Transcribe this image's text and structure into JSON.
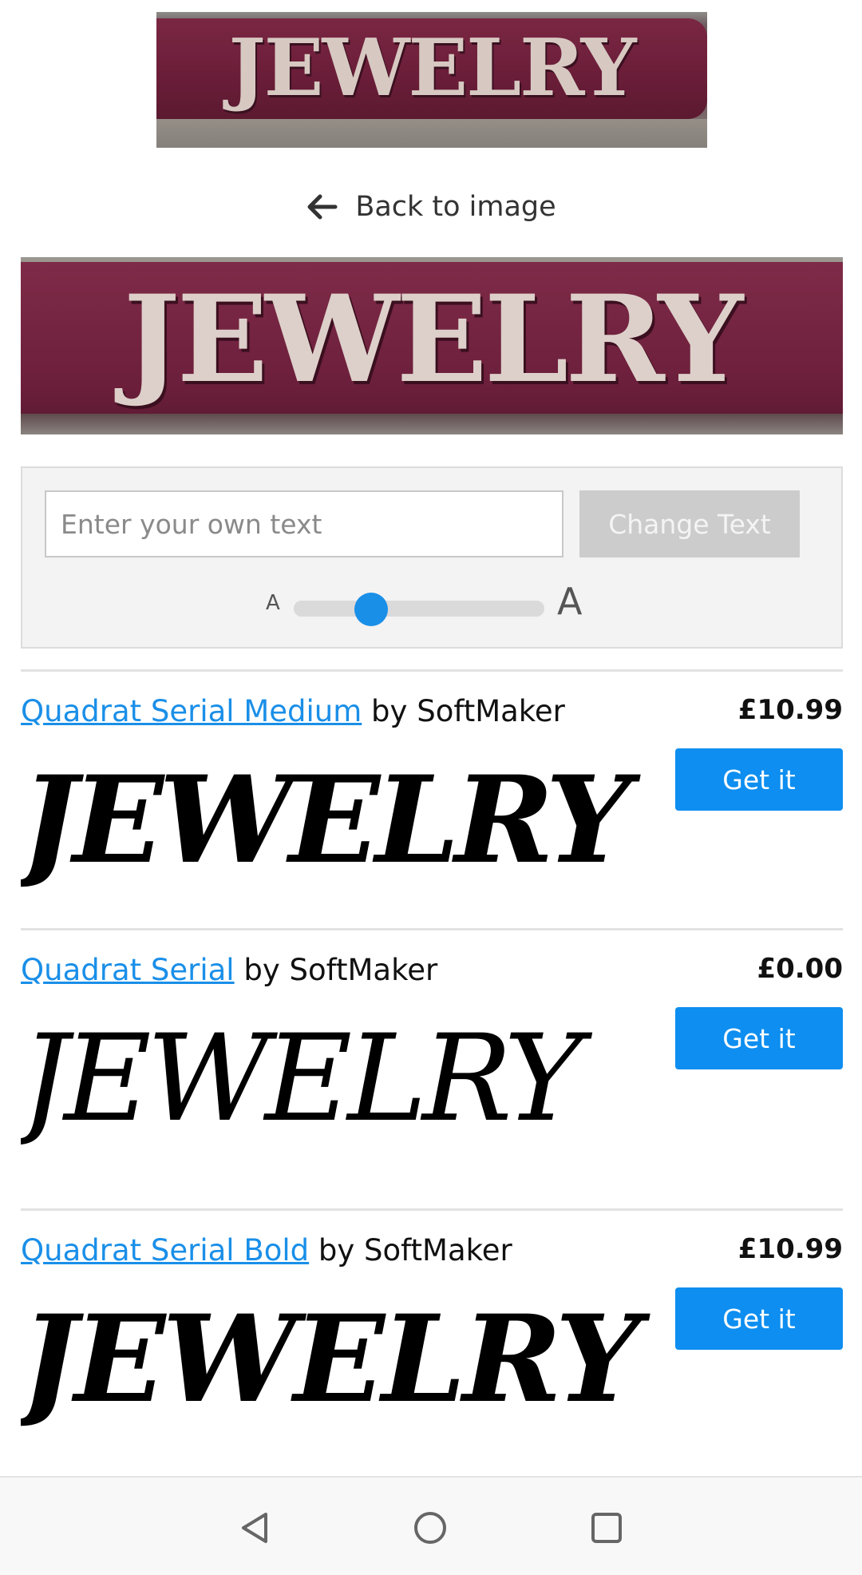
{
  "thumbnail": {
    "sign_text": "JEWELRY"
  },
  "back_link": {
    "label": "Back to image"
  },
  "crop": {
    "sign_text": "JEWELRY"
  },
  "controls": {
    "text_input_placeholder": "Enter your own text",
    "text_input_value": "",
    "change_text_label": "Change Text",
    "size_small_label": "A",
    "size_large_label": "A",
    "size_slider_fraction": 0.31,
    "accent_color": "#1a8fe8"
  },
  "results": [
    {
      "font_name": "Quadrat Serial Medium",
      "by_text": " by SoftMaker",
      "price": "£10.99",
      "button_label": "Get it",
      "sample": "JEWELRY"
    },
    {
      "font_name": "Quadrat Serial",
      "by_text": " by SoftMaker",
      "price": "£0.00",
      "button_label": "Get it",
      "sample": "JEWELRY"
    },
    {
      "font_name": "Quadrat Serial Bold",
      "by_text": " by SoftMaker",
      "price": "£10.99",
      "button_label": "Get it",
      "sample": "JEWELRY"
    }
  ],
  "navbar": {
    "icons": [
      "back-triangle-icon",
      "home-circle-icon",
      "recents-square-icon"
    ]
  }
}
